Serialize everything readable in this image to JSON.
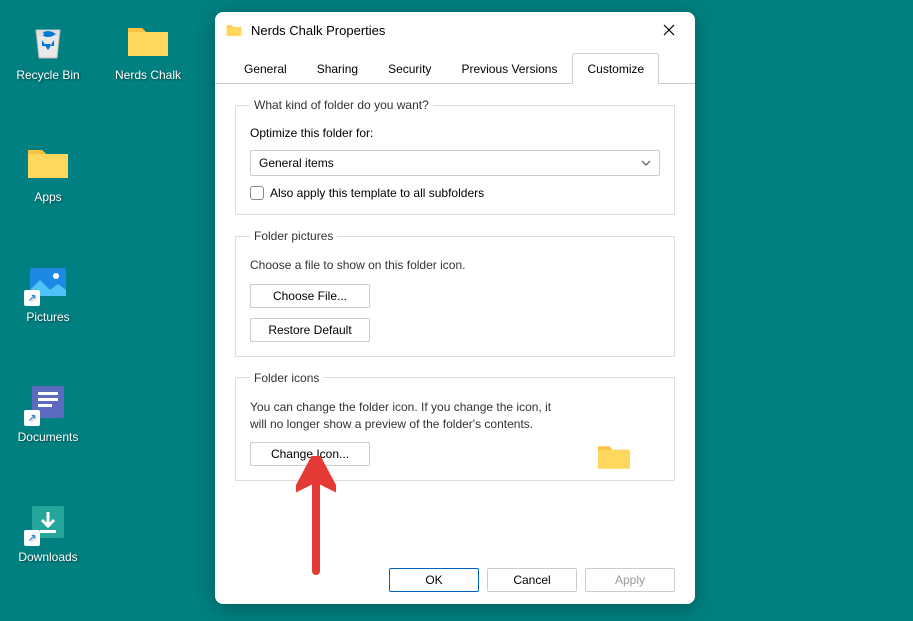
{
  "desktop": {
    "icons": [
      {
        "label": "Recycle Bin"
      },
      {
        "label": "Nerds Chalk"
      },
      {
        "label": "Apps"
      },
      {
        "label": "Pictures"
      },
      {
        "label": "Documents"
      },
      {
        "label": "Downloads"
      }
    ]
  },
  "dialog": {
    "title": "Nerds Chalk Properties",
    "tabs": {
      "general": "General",
      "sharing": "Sharing",
      "security": "Security",
      "previous": "Previous Versions",
      "customize": "Customize"
    },
    "group1": {
      "legend": "What kind of folder do you want?",
      "optimize_label": "Optimize this folder for:",
      "select_value": "General items",
      "subfolders_label": "Also apply this template to all subfolders"
    },
    "group2": {
      "legend": "Folder pictures",
      "desc": "Choose a file to show on this folder icon.",
      "choose": "Choose File...",
      "restore": "Restore Default"
    },
    "group3": {
      "legend": "Folder icons",
      "desc": "You can change the folder icon. If you change the icon, it will no longer show a preview of the folder's contents.",
      "change": "Change Icon..."
    },
    "buttons": {
      "ok": "OK",
      "cancel": "Cancel",
      "apply": "Apply"
    }
  }
}
